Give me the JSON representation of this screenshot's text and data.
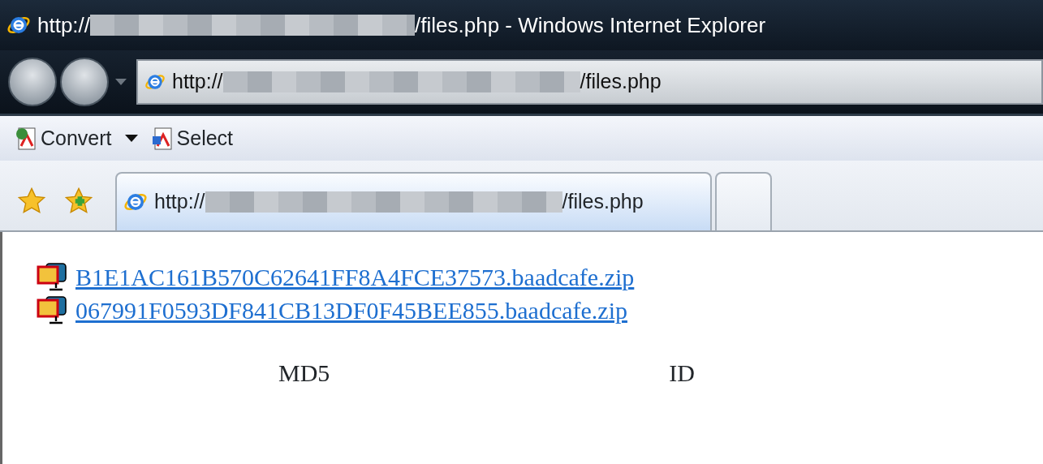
{
  "window": {
    "title_prefix": "http://",
    "title_redacted": true,
    "title_suffix": "/files.php - Windows Internet Explorer"
  },
  "address_bar": {
    "prefix": "http://",
    "redacted": true,
    "suffix": "/files.php"
  },
  "command_bar": [
    {
      "label": "Convert",
      "kind": "dropdown"
    },
    {
      "label": "Select",
      "kind": "button"
    }
  ],
  "tabs": [
    {
      "prefix": "http://",
      "redacted": true,
      "suffix": "/files.php",
      "selected": true
    },
    {
      "selected": false
    }
  ],
  "files": [
    {
      "name": "B1E1AC161B570C62641FF8A4FCE37573.baadcafe.zip"
    },
    {
      "name": "067991F0593DF841CB13DF0F45BEE855.baadcafe.zip"
    }
  ],
  "labels": [
    "MD5",
    "ID"
  ]
}
